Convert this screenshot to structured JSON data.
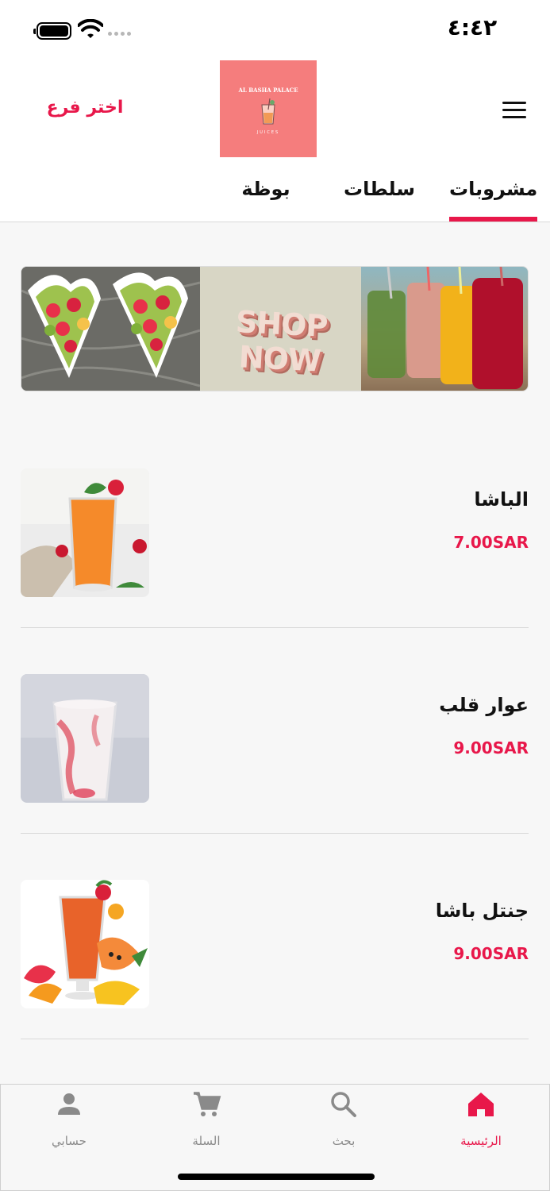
{
  "status_bar": {
    "time": "٤:٤٢",
    "icons": [
      "battery-icon",
      "wifi-icon",
      "signal-dots-icon"
    ]
  },
  "header": {
    "branch_select": "اختر فرع",
    "logo_title": "AL BASHA PALACE",
    "logo_subtitle": "JUICES",
    "menu_icon": "hamburger-menu-icon"
  },
  "tabs": [
    {
      "label": "مشروبات",
      "active": true
    },
    {
      "label": "سلطات",
      "active": false
    },
    {
      "label": "بوظة",
      "active": false
    }
  ],
  "banner": {
    "text": "SHOP NOW"
  },
  "products": [
    {
      "name": "الباشا",
      "price": "7.00SAR",
      "image": "orange-juice-image"
    },
    {
      "name": "عوار قلب",
      "price": "9.00SAR",
      "image": "strawberry-milk-image"
    },
    {
      "name": "جنتل باشا",
      "price": "9.00SAR",
      "image": "papaya-juice-image"
    }
  ],
  "bottom_nav": [
    {
      "label": "حسابي",
      "icon": "person-icon",
      "active": false
    },
    {
      "label": "السلة",
      "icon": "cart-icon",
      "active": false
    },
    {
      "label": "بحث",
      "icon": "search-icon",
      "active": false
    },
    {
      "label": "الرئيسية",
      "icon": "home-icon",
      "active": true
    }
  ],
  "colors": {
    "accent": "#e8174a",
    "logo_bg": "#f57d7d",
    "inactive_nav": "#8a8a8a"
  }
}
